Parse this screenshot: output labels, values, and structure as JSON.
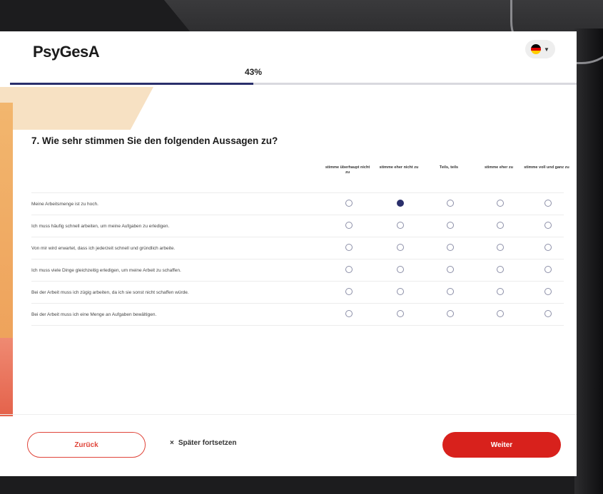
{
  "app": {
    "logo": "PsyGesA"
  },
  "language": {
    "current": "DE",
    "flag_colors": [
      "#000000",
      "#dd0000",
      "#ffce00"
    ]
  },
  "progress": {
    "label": "43%",
    "value": 0.43,
    "color": "#2a2f6b"
  },
  "question": {
    "title": "7. Wie sehr stimmen Sie den folgenden Aussagen zu?",
    "columns": [
      "stimme überhaupt nicht zu",
      "stimme eher nicht zu",
      "Teils, teils",
      "stimme eher zu",
      "stimme voll und ganz zu"
    ],
    "rows": [
      {
        "label": "Meine Arbeitsmenge ist zu hoch.",
        "selected": 1
      },
      {
        "label": "Ich muss häufig schnell arbeiten, um meine Aufgaben zu erledigen.",
        "selected": -1
      },
      {
        "label": "Von mir wird erwartet, dass ich jederzeit schnell und gründlich arbeite.",
        "selected": -1
      },
      {
        "label": "Ich muss viele Dinge gleichzeitig erledigen, um meine Arbeit zu schaffen.",
        "selected": -1
      },
      {
        "label": "Bei der Arbeit muss ich zügig arbeiten, da ich sie sonst nicht schaffen würde.",
        "selected": -1
      },
      {
        "label": "Bei der Arbeit muss ich eine Menge an Aufgaben bewältigen.",
        "selected": -1
      }
    ]
  },
  "footer": {
    "back_label": "Zurück",
    "later_icon": "close-icon",
    "later_label": "Später fortsetzen",
    "next_label": "Weiter",
    "accent": "#d8211c"
  }
}
